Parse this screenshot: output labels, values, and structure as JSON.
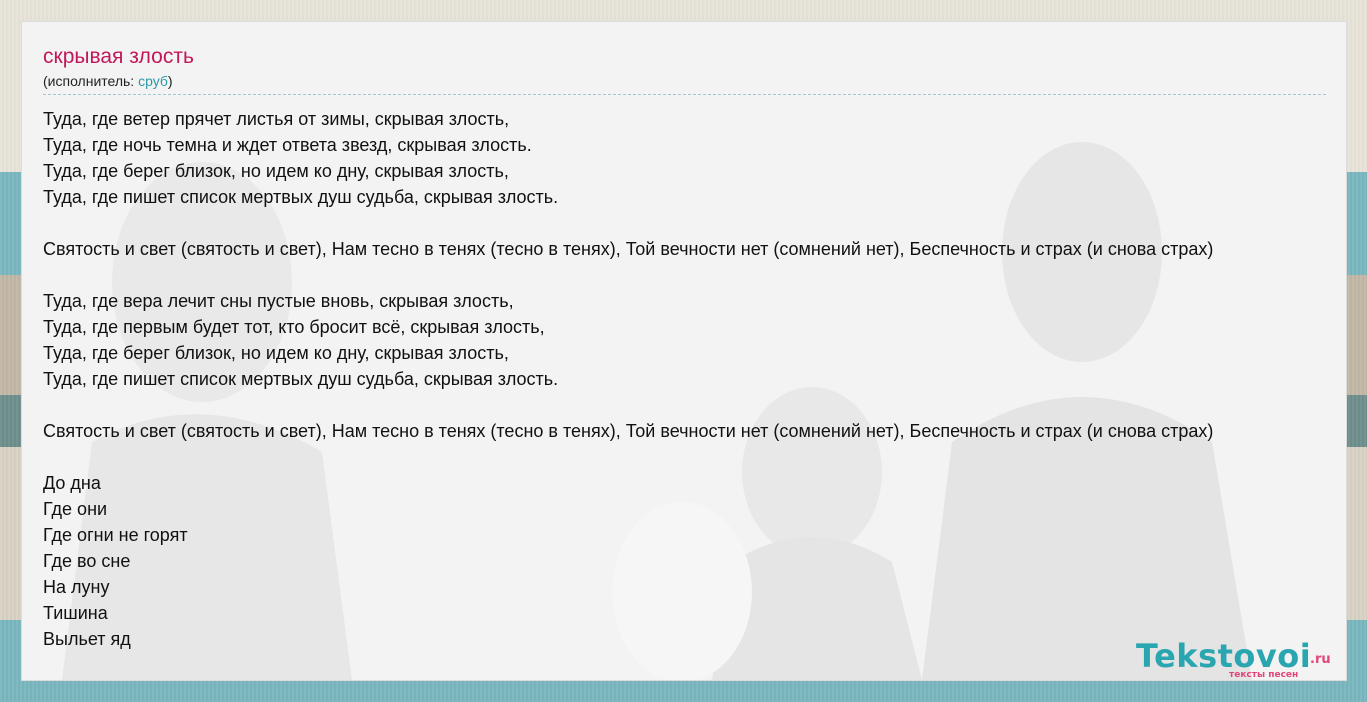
{
  "song": {
    "title": "скрывая злость",
    "artist_prefix": "(исполнитель: ",
    "artist_name": "сруб",
    "artist_suffix": ")"
  },
  "lyrics": [
    "Туда, где ветер прячет листья от зимы, скрывая злость,",
    "Туда, где ночь темна и ждет ответа звезд, скрывая злость.",
    "Туда, где берег близок, но идем ко дну, скрывая злость,",
    "Туда, где пишет список мертвых душ судьба, скрывая злость.",
    "",
    "Святость и свет (святость и свет), Нам тесно в тенях (тесно в тенях), Той вечности нет (сомнений нет), Беспечность и страх (и снова страх)",
    "",
    "Туда, где вера лечит сны пустые вновь, скрывая злость,",
    "Туда, где первым будет тот, кто бросит всё, скрывая злость,",
    "Туда, где берег близок, но идем ко дну, скрывая злость,",
    "Туда, где пишет список мертвых душ судьба, скрывая злость.",
    "",
    "Святость и свет (святость и свет), Нам тесно в тенях (тесно в тенях), Той вечности нет (сомнений нет), Беспечность и страх (и снова страх)",
    "",
    "До дна",
    "Где они",
    "Где огни не горят",
    "Где во сне",
    "На луну",
    "Тишина",
    "Выльет яд"
  ],
  "logo": {
    "main": "Tekstovoi",
    "tld": ".ru",
    "subtitle": "тексты песен"
  },
  "colors": {
    "title": "#c2185b",
    "link": "#2b9aa8",
    "logo_main": "#2aa6b0",
    "logo_accent": "#e0457b"
  }
}
